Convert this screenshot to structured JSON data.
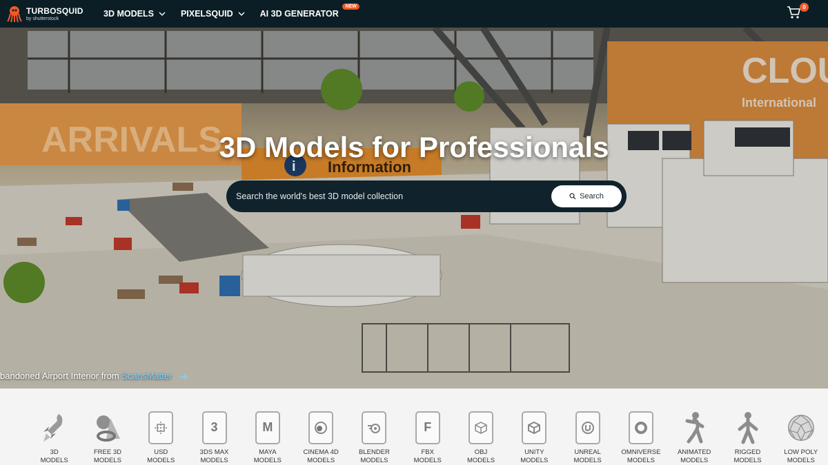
{
  "nav": {
    "logo_name": "TURBOSQUID",
    "logo_sub": "by shutterstock",
    "menu": [
      {
        "label": "3D MODELS"
      },
      {
        "label": "PIXELSQUID"
      },
      {
        "label": "AI 3D GENERATOR",
        "badge": "NEW"
      }
    ],
    "cart_count": "0"
  },
  "hero": {
    "title": "3D Models for Professionals",
    "search_placeholder": "Search the world's best 3D model collection",
    "search_button": "Search",
    "credit_text": "bandoned Airport Interior from ",
    "credit_link": "ScansMatter",
    "scene_signs": {
      "arrivals": "ARRIVALS",
      "information": "Information",
      "cloud": "CLOU",
      "international": "International"
    }
  },
  "categories": [
    {
      "line1": "3D",
      "line2": "MODELS",
      "icon": "rocket-icon"
    },
    {
      "line1": "FREE 3D",
      "line2": "MODELS",
      "icon": "free-shapes-icon"
    },
    {
      "line1": "USD",
      "line2": "MODELS",
      "icon": "usd-file-icon"
    },
    {
      "line1": "3DS MAX",
      "line2": "MODELS",
      "icon": "3dsmax-file-icon",
      "glyph": "3"
    },
    {
      "line1": "MAYA",
      "line2": "MODELS",
      "icon": "maya-file-icon",
      "glyph": "M"
    },
    {
      "line1": "CINEMA 4D",
      "line2": "MODELS",
      "icon": "cinema4d-file-icon"
    },
    {
      "line1": "BLENDER",
      "line2": "MODELS",
      "icon": "blender-file-icon"
    },
    {
      "line1": "FBX",
      "line2": "MODELS",
      "icon": "fbx-file-icon",
      "glyph": "F"
    },
    {
      "line1": "OBJ",
      "line2": "MODELS",
      "icon": "obj-file-icon"
    },
    {
      "line1": "UNITY",
      "line2": "MODELS",
      "icon": "unity-file-icon"
    },
    {
      "line1": "UNREAL",
      "line2": "MODELS",
      "icon": "unreal-file-icon"
    },
    {
      "line1": "OMNIVERSE",
      "line2": "MODELS",
      "icon": "omniverse-file-icon"
    },
    {
      "line1": "ANIMATED",
      "line2": "MODELS",
      "icon": "animated-figure-icon"
    },
    {
      "line1": "RIGGED",
      "line2": "MODELS",
      "icon": "rigged-figure-icon"
    },
    {
      "line1": "LOW POLY",
      "line2": "MODELS",
      "icon": "low-poly-sphere-icon"
    }
  ],
  "colors": {
    "nav_bg": "#0b1e26",
    "accent": "#f05a28",
    "link": "#7fd3ff"
  }
}
